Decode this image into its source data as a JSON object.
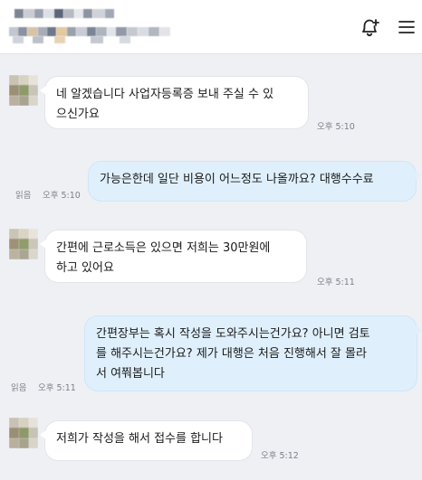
{
  "header": {
    "contact_name": "",
    "icons": [
      "notification-add-icon",
      "hamburger-menu-icon"
    ]
  },
  "messages": [
    {
      "direction": "incoming",
      "lines": [
        "네 알겠습니다 사업자등록증 보내 주실 수 있",
        "으신가요"
      ],
      "time": "오후 5:10"
    },
    {
      "direction": "outgoing",
      "lines": [
        "가능은한데 일단 비용이 어느정도 나올까요? 대행수수료"
      ],
      "time": "오후 5:10",
      "status": "읽음"
    },
    {
      "direction": "incoming",
      "lines": [
        "간편에 근로소득은 있으면 저희는 30만원에",
        "하고 있어요"
      ],
      "time": "오후 5:11"
    },
    {
      "direction": "outgoing",
      "lines": [
        "간편장부는 혹시 작성을 도와주시는건가요? 아니면 검토",
        "를 해주시는건가요? 제가 대행은 처음 진행해서 잘 몰라",
        "서 여쭤봅니다"
      ],
      "time": "오후 5:11",
      "status": "읽음"
    },
    {
      "direction": "incoming",
      "lines": [
        "저희가 작성을 해서 접수를 합니다"
      ],
      "time": "오후 5:12"
    }
  ],
  "colors": {
    "background": "#eef0f4",
    "incoming_bubble": "#ffffff",
    "outgoing_bubble": "#dff0fc",
    "meta_text": "#7c8088"
  }
}
